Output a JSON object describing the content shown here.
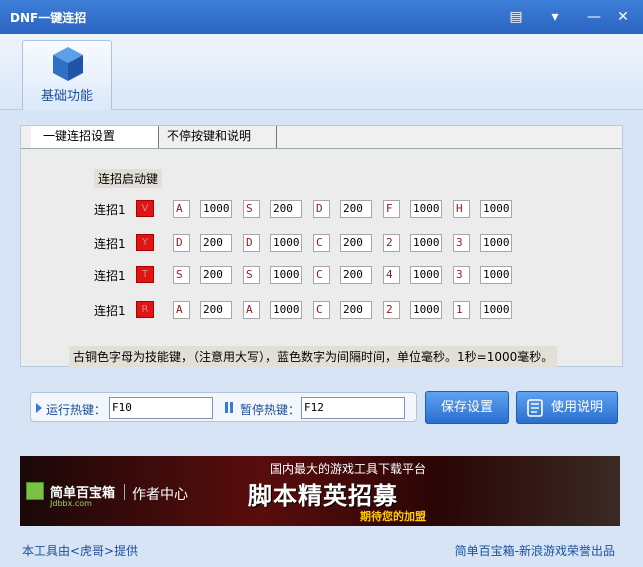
{
  "window": {
    "title": "DNF一键连招"
  },
  "top_tab": {
    "label": "基础功能"
  },
  "tabs": [
    {
      "label": "一键连招设置"
    },
    {
      "label": "不停按键和说明"
    }
  ],
  "combo": {
    "header": "连招启动键",
    "rows": [
      {
        "label": "连招1",
        "trigger": "V",
        "cells": [
          "A",
          "1000",
          "S",
          "200",
          "D",
          "200",
          "F",
          "1000",
          "H",
          "1000"
        ]
      },
      {
        "label": "连招1",
        "trigger": "Y",
        "cells": [
          "D",
          "200",
          "D",
          "1000",
          "C",
          "200",
          "2",
          "1000",
          "3",
          "1000"
        ]
      },
      {
        "label": "连招1",
        "trigger": "T",
        "cells": [
          "S",
          "200",
          "S",
          "1000",
          "C",
          "200",
          "4",
          "1000",
          "3",
          "1000"
        ]
      },
      {
        "label": "连招1",
        "trigger": "R",
        "cells": [
          "A",
          "200",
          "A",
          "1000",
          "C",
          "200",
          "2",
          "1000",
          "1",
          "1000"
        ]
      }
    ],
    "note": "古铜色字母为技能键，（注意用大写），蓝色数字为间隔时间，单位毫秒。1秒=1000毫秒。"
  },
  "hotkeys": {
    "run_label": "运行热键：",
    "run_value": "F10",
    "pause_label": "暂停热键：",
    "pause_value": "F12"
  },
  "buttons": {
    "save": "保存设置",
    "help": "使用说明"
  },
  "banner": {
    "logo": "简单百宝箱",
    "logo_sub": "Jdbbx.com",
    "center": "作者中心",
    "line1": "国内最大的游戏工具下载平台",
    "line2": "脚本精英招募",
    "line3": "期待您的加盟"
  },
  "footer": {
    "left": "本工具由<虎哥>提供",
    "right": "简单百宝箱-新浪游戏荣誉出品"
  },
  "colors": {
    "titlebar": "#2a64c0",
    "trigger": "#e11414",
    "key_text": "#8b1a1a",
    "button": "#2a6fd0"
  }
}
